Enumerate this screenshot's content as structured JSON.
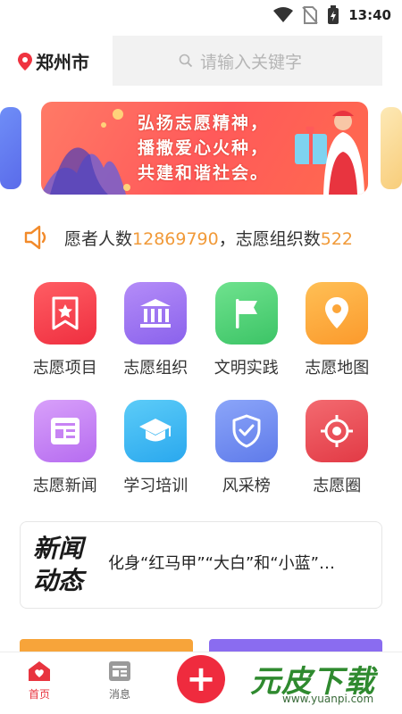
{
  "status": {
    "time": "13:40"
  },
  "header": {
    "city": "郑州市",
    "search_placeholder": "请输入关键字"
  },
  "banner": {
    "lines": [
      "弘扬志愿精神，",
      "播撒爱心火种，",
      "共建和谐社会。"
    ]
  },
  "notice": {
    "prefix": "愿者人数",
    "volunteers": "12869790",
    "middle": "，志愿组织数",
    "orgs": "522"
  },
  "grid": {
    "row1": [
      {
        "label": "志愿项目",
        "icon": "bookmark-star-icon",
        "color": "#f4424f"
      },
      {
        "label": "志愿组织",
        "icon": "institution-icon",
        "color": "#9a74f2"
      },
      {
        "label": "文明实践",
        "icon": "flag-icon",
        "color": "#4fd07a"
      },
      {
        "label": "志愿地图",
        "icon": "map-pin-icon",
        "color": "#fca63a"
      }
    ],
    "row2": [
      {
        "label": "志愿新闻",
        "icon": "newspaper-icon",
        "color": "#c783f4"
      },
      {
        "label": "学习培训",
        "icon": "graduation-cap-icon",
        "color": "#37b8f2"
      },
      {
        "label": "风采榜",
        "icon": "shield-check-icon",
        "color": "#6e8cf3"
      },
      {
        "label": "志愿圈",
        "icon": "target-icon",
        "color": "#ef4a52"
      }
    ]
  },
  "news": {
    "logo_line1": "新闻",
    "logo_line2": "动态",
    "title": "化身“红马甲”“大白”和“小蓝”…"
  },
  "tabbar": {
    "home_label": "首页",
    "home_color": "#e8343f",
    "messages_label": "消息",
    "messages_color": "#888888",
    "fab_label": "+"
  },
  "watermark": {
    "main": "元皮下载",
    "sub": "www.yuanpi.com"
  }
}
